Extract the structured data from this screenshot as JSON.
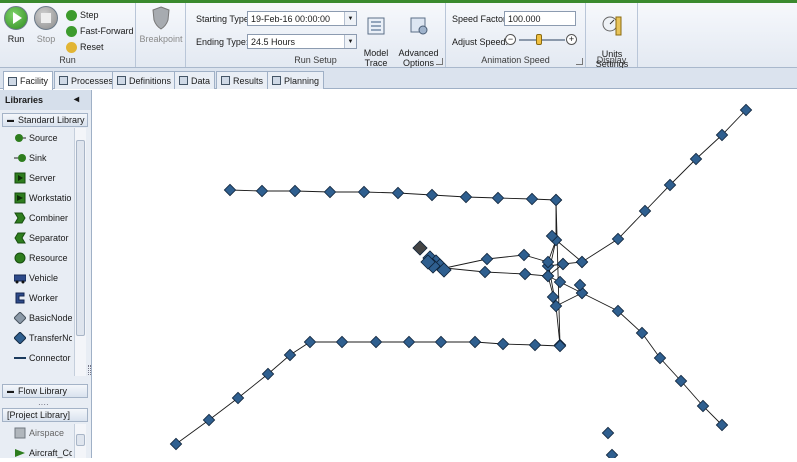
{
  "ribbon": {
    "run_group": {
      "run": "Run",
      "stop": "Stop",
      "step": "Step",
      "fast_forward": "Fast-Forward",
      "reset": "Reset",
      "label": "Run"
    },
    "breakpoint": "Breakpoint",
    "setup": {
      "starting_type_label": "Starting Type:",
      "starting_type_value": "19-Feb-16 00:00:00",
      "ending_type_label": "Ending Type:",
      "ending_type_value": "24.5 Hours",
      "label": "Run Setup"
    },
    "model_trace": "Model\nTrace",
    "advanced_options": "Advanced\nOptions",
    "animation": {
      "speed_factor_label": "Speed Factor:",
      "speed_factor_value": "100.000",
      "adjust_speed_label": "Adjust Speed:",
      "label": "Animation Speed"
    },
    "units_settings": "Units\nSettings",
    "display_label": "Display",
    "colors": {
      "accent_green": "#3a8a2e",
      "node_blue": "#2f5f8f"
    }
  },
  "tabs": [
    "Facility",
    "Processes",
    "Definitions",
    "Data",
    "Results",
    "Planning"
  ],
  "sidebar": {
    "title": "Libraries",
    "standard_library": "Standard Library",
    "items": [
      "Source",
      "Sink",
      "Server",
      "Workstation",
      "Combiner",
      "Separator",
      "Resource",
      "Vehicle",
      "Worker",
      "BasicNode",
      "TransferNod",
      "Connector"
    ],
    "flow_library": "Flow Library",
    "project_library": "[Project Library]",
    "project_items": [
      "Airspace",
      "Aircraft_CdG"
    ]
  },
  "icons": {
    "run": "play-icon",
    "stop": "stop-icon",
    "step": "step-icon",
    "fast_forward": "fast-forward-icon",
    "reset": "reset-icon",
    "breakpoint": "shield-icon",
    "model_trace": "trace-icon",
    "advanced_options": "gear-icon",
    "units_settings": "gauge-icon",
    "collapse": "chevron-left-icon"
  }
}
